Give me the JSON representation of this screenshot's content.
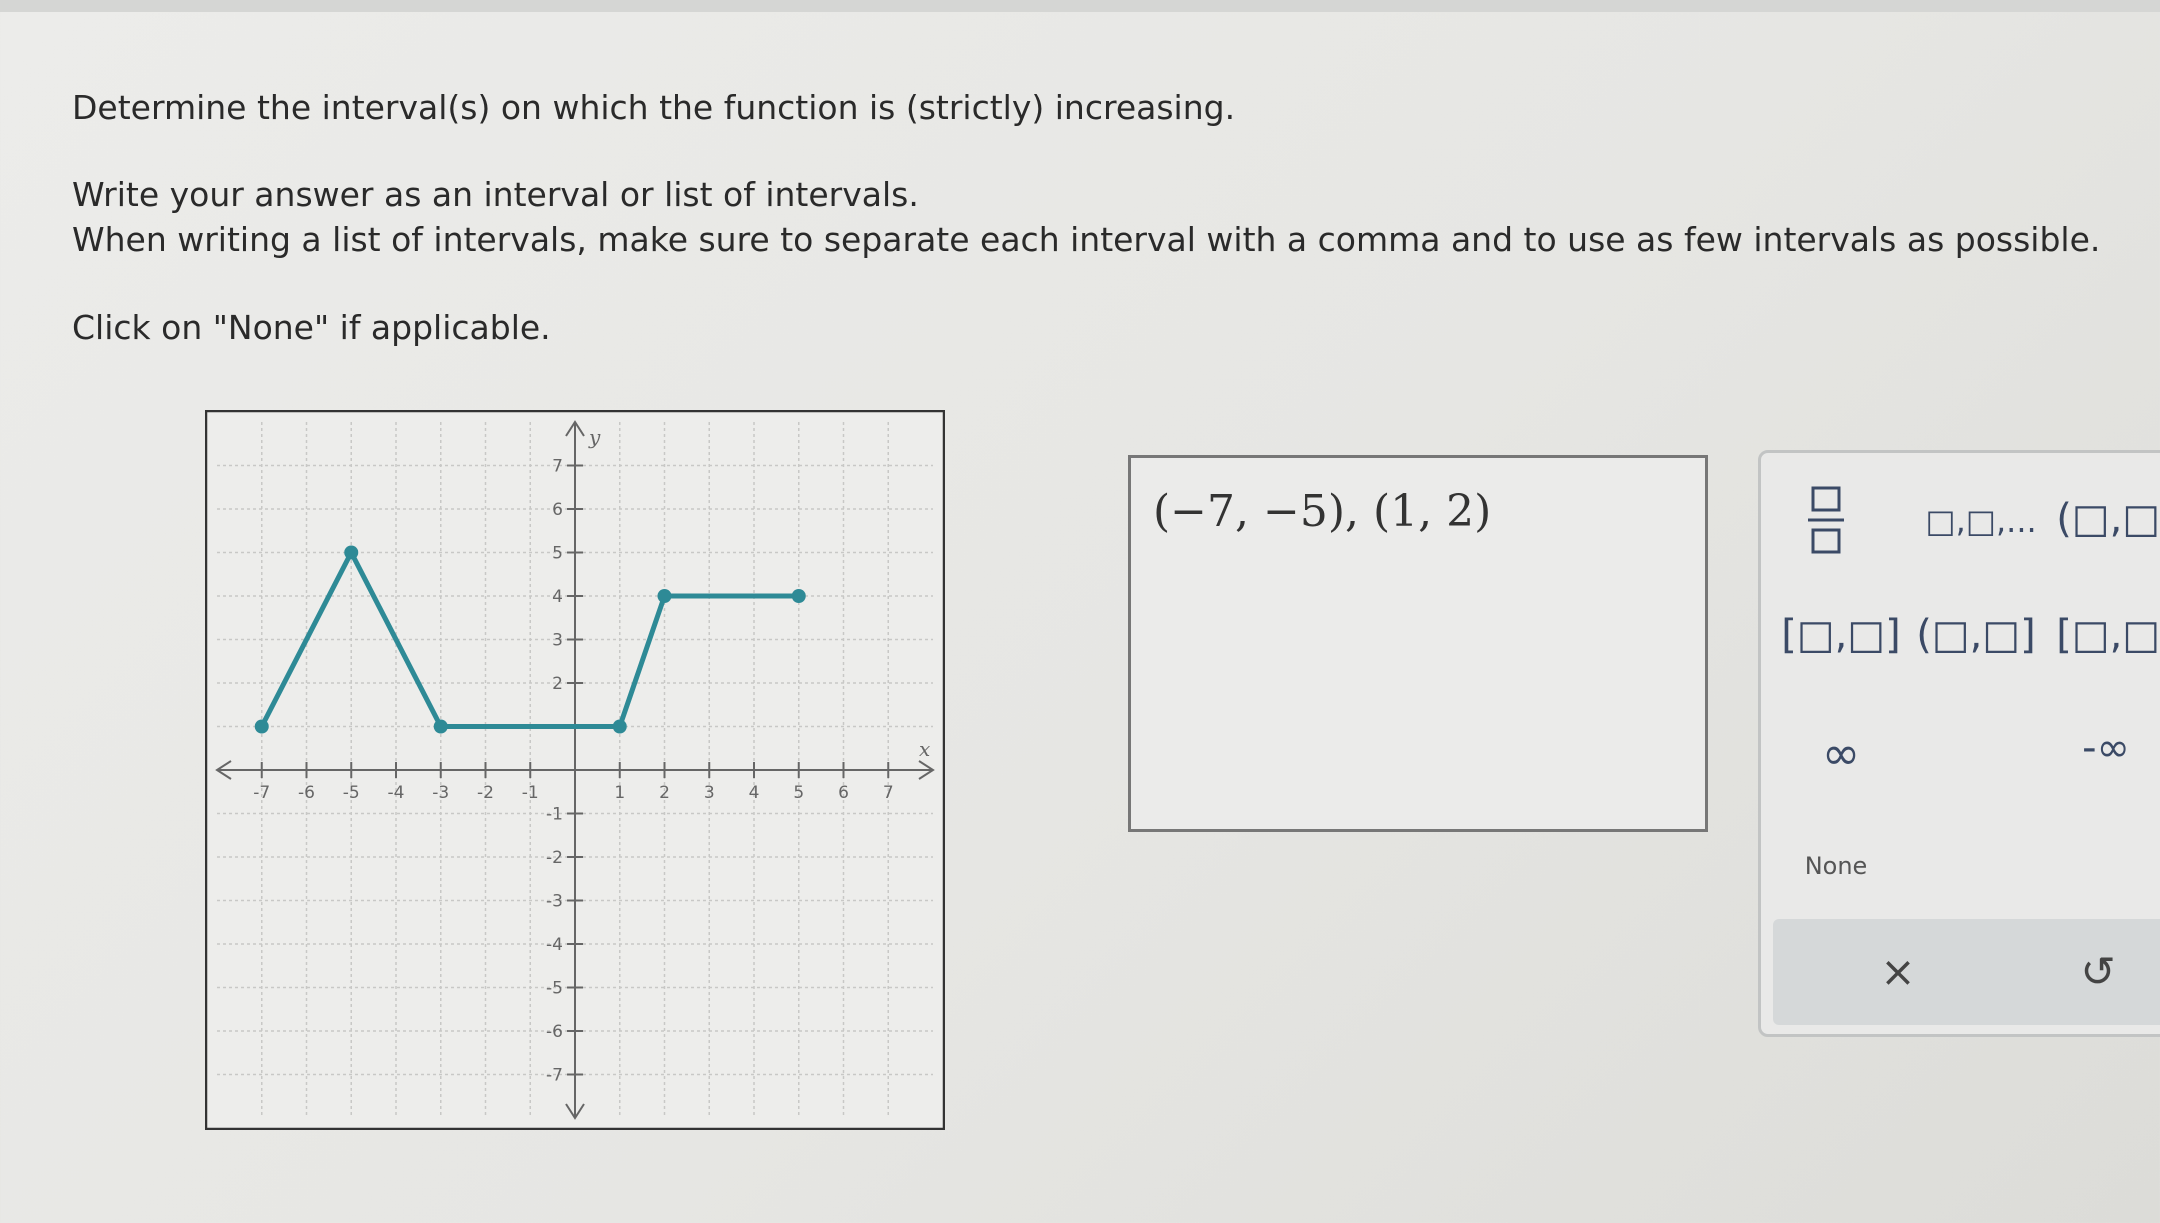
{
  "question": {
    "line1": "Determine the interval(s) on which the function is (strictly) increasing.",
    "line2": "Write your answer as an interval or list of intervals.",
    "line3": "When writing a list of intervals, make sure to separate each interval with a comma and to use as few intervals as possible.",
    "line4": "Click on \"None\" if applicable."
  },
  "graph": {
    "x_axis_label": "x",
    "y_axis_label": "y",
    "x_ticks": [
      -7,
      -6,
      -5,
      -4,
      -3,
      -2,
      -1,
      1,
      2,
      3,
      4,
      5,
      6,
      7
    ],
    "y_ticks": [
      -7,
      -6,
      -5,
      -4,
      -3,
      -2,
      -1,
      2,
      3,
      4,
      5,
      6,
      7
    ],
    "range": {
      "x": [
        -8,
        8
      ],
      "y": [
        -8,
        8
      ]
    },
    "grid": true,
    "line_color": "#2e8a96",
    "points": [
      [
        -7,
        1
      ],
      [
        -5,
        5
      ],
      [
        -3,
        1
      ],
      [
        1,
        1
      ],
      [
        2,
        4
      ],
      [
        5,
        4
      ]
    ]
  },
  "answer": {
    "text": "(−7, −5), (1, 2)"
  },
  "keypad": {
    "frac": "□/□",
    "list": "□,□,...",
    "open_open": "(□,□)",
    "closed_closed": "[□,□]",
    "open_closed": "(□,□]",
    "closed_open": "[□,□)",
    "infinity": "∞",
    "neg_infinity": "-∞",
    "none": "None",
    "clear": "×",
    "undo": "↺"
  },
  "colors": {
    "accent": "#2e8a96",
    "key_text": "#3b4a66"
  }
}
